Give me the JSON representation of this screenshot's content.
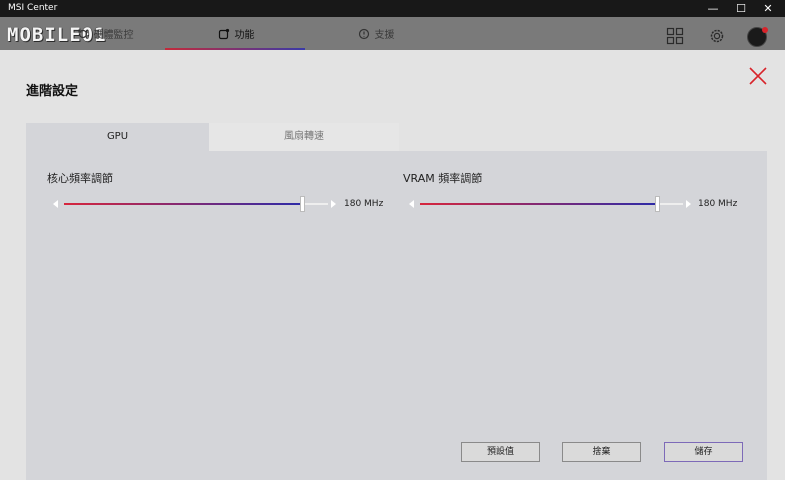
{
  "window": {
    "app_name": "MSI Center",
    "minimize": "—",
    "maximize": "☐",
    "close": "✕"
  },
  "header": {
    "logo": "MOBILE01",
    "tabs": [
      {
        "label": "硬體監控",
        "icon": "refresh-icon"
      },
      {
        "label": "功能",
        "icon": "feature-icon",
        "active": true
      },
      {
        "label": "支援",
        "icon": "support-icon"
      }
    ],
    "icons": [
      "grid-icon",
      "gear-icon",
      "avatar"
    ]
  },
  "dialog": {
    "title": "進階設定",
    "subtabs": [
      {
        "label": "GPU",
        "active": true
      },
      {
        "label": "風扇轉速",
        "active": false
      }
    ],
    "sliders": [
      {
        "label": "核心頻率調節",
        "value": "180 MHz",
        "fraction": 0.9
      },
      {
        "label": "VRAM 頻率調節",
        "value": "180 MHz",
        "fraction": 0.9
      }
    ],
    "buttons": {
      "default": "預設值",
      "discard": "捨棄",
      "save": "儲存"
    }
  },
  "colors": {
    "accent_red": "#d7263d",
    "accent_blue": "#2d2ba8",
    "close_x": "#d8232a"
  }
}
